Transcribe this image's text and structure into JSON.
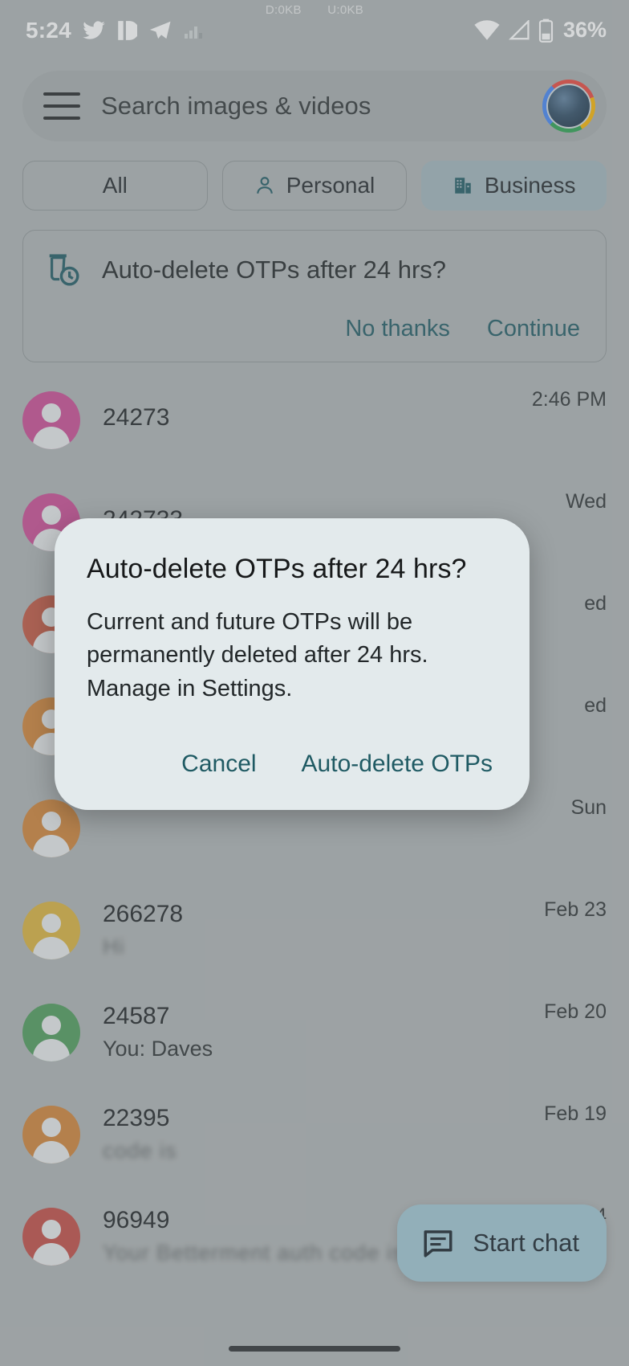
{
  "status_bar": {
    "time": "5:24",
    "network_download": "D:0KB",
    "network_upload": "U:0KB",
    "battery_percent": "36%",
    "icons": [
      "twitter-icon",
      "pushbullet-icon",
      "telegram-icon",
      "signal-bars-icon",
      "wifi-icon",
      "cellular-signal-icon",
      "battery-icon"
    ]
  },
  "search": {
    "menu_icon": "hamburger-menu-icon",
    "placeholder": "Search images & videos",
    "avatar": "account-avatar"
  },
  "filters": [
    {
      "label": "All",
      "icon": null,
      "selected": false
    },
    {
      "label": "Personal",
      "icon": "person-icon",
      "selected": false
    },
    {
      "label": "Business",
      "icon": "business-building-icon",
      "selected": true
    }
  ],
  "promo_card": {
    "icon": "delete-clock-icon",
    "title": "Auto-delete OTPs after 24 hrs?",
    "decline_label": "No thanks",
    "accept_label": "Continue"
  },
  "conversations": [
    {
      "name": "24273",
      "snippet": "",
      "time": "2:46 PM",
      "avatar_color": "#c94a93",
      "name_redacted": false,
      "snippet_redacted": true
    },
    {
      "name": "242733",
      "snippet": "",
      "time": "Wed",
      "avatar_color": "#c94a93",
      "name_redacted": false,
      "snippet_redacted": true
    },
    {
      "name": "",
      "snippet": "",
      "time": "ed",
      "avatar_color": "#c0553f",
      "name_redacted": true,
      "snippet_redacted": true
    },
    {
      "name": "",
      "snippet": "",
      "time": "ed",
      "avatar_color": "#cf8136",
      "name_redacted": true,
      "snippet_redacted": true
    },
    {
      "name": "",
      "snippet": "",
      "time": "Sun",
      "avatar_color": "#cf8136",
      "name_redacted": true,
      "snippet_redacted": true
    },
    {
      "name": "266278",
      "snippet": "Hi",
      "time": "Feb 23",
      "avatar_color": "#d9b03c",
      "name_redacted": false,
      "snippet_redacted": true
    },
    {
      "name": "24587",
      "snippet": "You: Daves",
      "time": "Feb 20",
      "avatar_color": "#4d9a5a",
      "name_redacted": false,
      "snippet_redacted": false
    },
    {
      "name": "22395",
      "snippet": "code is",
      "time": "Feb 19",
      "avatar_color": "#cf8136",
      "name_redacted": false,
      "snippet_redacted": true
    },
    {
      "name": "96949",
      "snippet": "Your Betterment auth code is",
      "time": "Feb 14",
      "avatar_color": "#c04a43",
      "name_redacted": false,
      "snippet_redacted": true
    }
  ],
  "fab": {
    "icon": "chat-message-icon",
    "label": "Start chat"
  },
  "dialog": {
    "title": "Auto-delete OTPs after 24 hrs?",
    "body": "Current and future OTPs will be permanently deleted after 24 hrs. Manage in Settings.",
    "cancel_label": "Cancel",
    "confirm_label": "Auto-delete OTPs"
  },
  "colors": {
    "accent_teal": "#1f5a63",
    "chip_selected": "#9fb4bb",
    "dialog_surface": "#e3eaec",
    "fab_surface": "#9ec4d2",
    "app_background": "#adb2b3"
  }
}
